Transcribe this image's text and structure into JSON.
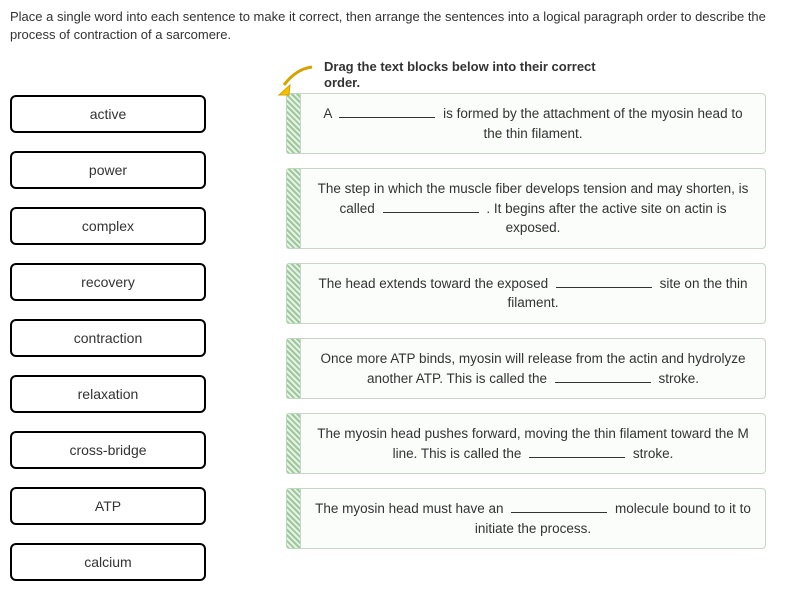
{
  "instructions": "Place a single word into each sentence to make it correct, then arrange the sentences into a logical paragraph order to describe the process of contraction of a sarcomere.",
  "hint": "Drag the text blocks below into their correct order.",
  "words": [
    "active",
    "power",
    "complex",
    "recovery",
    "contraction",
    "relaxation",
    "cross-bridge",
    "ATP",
    "calcium"
  ],
  "sentences": [
    {
      "pre": "A ",
      "post": " is formed by the attachment of the myosin head to the thin filament."
    },
    {
      "pre": "The step in which the muscle fiber develops tension and may shorten, is called ",
      "post": " . It begins after the active site on actin is exposed."
    },
    {
      "pre": "The head extends toward the exposed ",
      "post": " site on the thin filament."
    },
    {
      "pre": "Once more ATP binds, myosin will release from the actin and hydrolyze another ATP. This is called the ",
      "post": " stroke."
    },
    {
      "pre": "The myosin head pushes forward, moving the thin filament toward the M line. This is called the ",
      "post": " stroke."
    },
    {
      "pre": "The myosin head must have an ",
      "post": " molecule bound to it to initiate the process."
    }
  ]
}
